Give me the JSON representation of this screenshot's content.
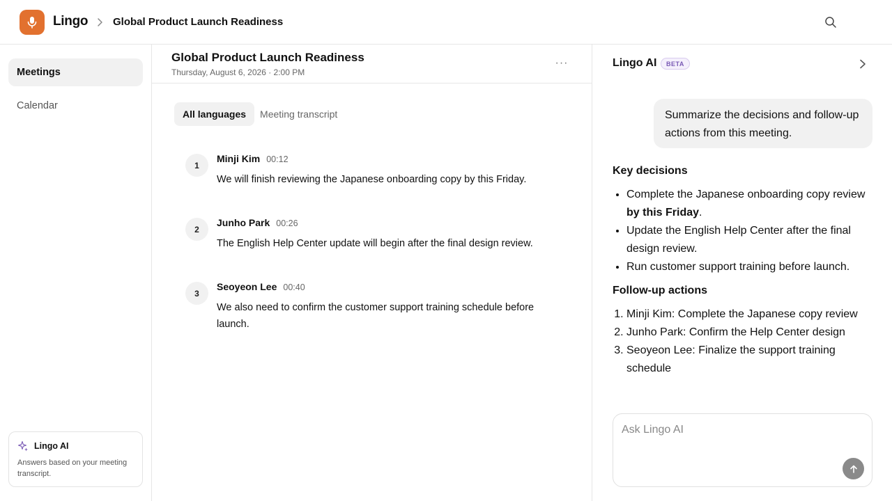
{
  "header": {
    "brand": "Lingo",
    "breadcrumb_title": "Global Product Launch Readiness",
    "icons": {
      "logo": "microphone-icon",
      "separator": "chevron-right-icon",
      "search": "search-icon"
    },
    "accent_color": "#e2712f"
  },
  "sidebar": {
    "items": [
      {
        "label": "Meetings",
        "active": true
      },
      {
        "label": "Calendar",
        "active": false
      }
    ],
    "ai_card": {
      "title": "Lingo AI",
      "icon": "sparkle-icon",
      "description": "Answers based on your meeting transcript."
    }
  },
  "meeting": {
    "title": "Global Product Launch Readiness",
    "datetime": "Thursday, August 6, 2026 · 2:00 PM",
    "more_label": "···",
    "tabs": [
      {
        "label": "All languages",
        "active": true
      },
      {
        "label": "Meeting transcript",
        "active": false
      }
    ],
    "transcript": [
      {
        "index": "1",
        "speaker": "Minji Kim",
        "time": "00:12",
        "text": "We will finish reviewing the Japanese onboarding copy by this Friday."
      },
      {
        "index": "2",
        "speaker": "Junho Park",
        "time": "00:26",
        "text": "The English Help Center update will begin after the final design review."
      },
      {
        "index": "3",
        "speaker": "Seoyeon Lee",
        "time": "00:40",
        "text": "We also need to confirm the customer support training schedule before launch."
      }
    ]
  },
  "ai_panel": {
    "title": "Lingo AI",
    "badge": "BETA",
    "user_message": "Summarize the decisions and follow-up actions from this meeting.",
    "answer": {
      "decisions_heading": "Key decisions",
      "decisions": [
        {
          "text_before": "Complete the Japanese onboarding copy review ",
          "bold": "by this Friday",
          "text_after": "."
        },
        {
          "text_before": "Update the English Help Center after the final design review.",
          "bold": "",
          "text_after": ""
        },
        {
          "text_before": "Run customer support training before launch.",
          "bold": "",
          "text_after": ""
        }
      ],
      "actions_heading": "Follow-up actions",
      "actions": [
        "Minji Kim: Complete the Japanese copy review",
        "Junho Park: Confirm the Help Center design",
        "Seoyeon Lee: Finalize the support training schedule"
      ]
    },
    "ask": {
      "placeholder": "Ask Lingo AI",
      "value": ""
    },
    "icons": {
      "collapse": "chevron-right-icon",
      "send": "arrow-up-icon"
    }
  }
}
